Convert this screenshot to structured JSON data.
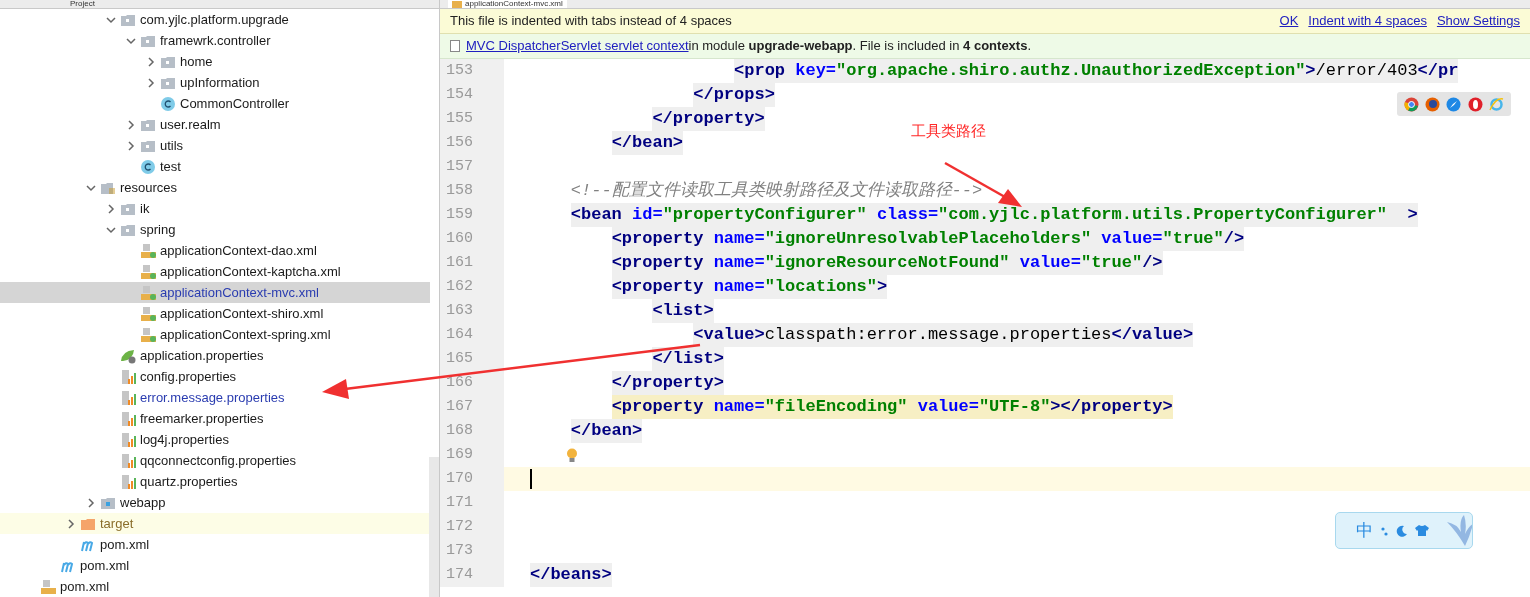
{
  "project_header": {
    "title": "Project"
  },
  "editor_tab": {
    "label": "applicationContext-mvc.xml",
    "selected": true
  },
  "tree": [
    {
      "children": [
        {
          "children": [
            {
              "children": [
                {
                  "children": [
                    {
                      "children": [
                        {
                          "label": "com.yjlc.platform.upgrade",
                          "kind": "package",
                          "expanded": true,
                          "children": [
                            {
                              "label": "framewrk.controller",
                              "kind": "package",
                              "expanded": true,
                              "children": [
                                {
                                  "label": "home",
                                  "kind": "package",
                                  "expanded": false
                                },
                                {
                                  "label": "upInformation",
                                  "kind": "package",
                                  "expanded": false
                                },
                                {
                                  "label": "CommonController",
                                  "kind": "class"
                                }
                              ]
                            },
                            {
                              "label": "user.realm",
                              "kind": "package",
                              "expanded": false
                            },
                            {
                              "label": "utils",
                              "kind": "package",
                              "expanded": false
                            },
                            {
                              "label": "test",
                              "kind": "class"
                            }
                          ]
                        }
                      ]
                    },
                    {
                      "label": "resources",
                      "kind": "resources",
                      "expanded": true,
                      "children": [
                        {
                          "label": "ik",
                          "kind": "package",
                          "expanded": false
                        },
                        {
                          "label": "spring",
                          "kind": "package",
                          "expanded": true,
                          "children": [
                            {
                              "label": "applicationContext-dao.xml",
                              "kind": "springxml",
                              "selected": false,
                              "modified": false
                            },
                            {
                              "label": "applicationContext-kaptcha.xml",
                              "kind": "springxml",
                              "selected": false,
                              "modified": false
                            },
                            {
                              "label": "applicationContext-mvc.xml",
                              "kind": "springxml",
                              "selected": true,
                              "modified": true
                            },
                            {
                              "label": "applicationContext-shiro.xml",
                              "kind": "springxml",
                              "selected": false,
                              "modified": false
                            },
                            {
                              "label": "applicationContext-spring.xml",
                              "kind": "springxml",
                              "selected": false,
                              "modified": false
                            }
                          ]
                        },
                        {
                          "label": "application.properties",
                          "kind": "springprops",
                          "selected": false,
                          "modified": false
                        },
                        {
                          "label": "config.properties",
                          "kind": "properties",
                          "selected": false,
                          "modified": false
                        },
                        {
                          "label": "error.message.properties",
                          "kind": "properties",
                          "selected": false,
                          "modified": true
                        },
                        {
                          "label": "freemarker.properties",
                          "kind": "properties",
                          "selected": false,
                          "modified": false
                        },
                        {
                          "label": "log4j.properties",
                          "kind": "properties",
                          "selected": false,
                          "modified": false
                        },
                        {
                          "label": "qqconnectconfig.properties",
                          "kind": "properties",
                          "selected": false,
                          "modified": false
                        },
                        {
                          "label": "quartz.properties",
                          "kind": "properties",
                          "selected": false,
                          "modified": false
                        }
                      ]
                    },
                    {
                      "label": "webapp",
                      "kind": "webapp",
                      "expanded": false
                    }
                  ]
                },
                {
                  "label": "target",
                  "kind": "target",
                  "expanded": false,
                  "excluded": true
                },
                {
                  "label": "pom.xml",
                  "kind": "maven"
                }
              ]
            },
            {
              "label": "pom.xml",
              "kind": "maven"
            }
          ]
        },
        {
          "label": "pom.xml",
          "kind": "xml"
        }
      ]
    }
  ],
  "notice": {
    "text": "This file is indented with tabs instead of 4 spaces",
    "links": [
      "OK",
      "Indent with 4 spaces",
      "Show Settings"
    ]
  },
  "context_bar": {
    "link": "MVC DispatcherServlet servlet context",
    "text": "in module **upgrade-webapp**. File is included in **4 contexts**."
  },
  "code_lines": [
    {
      "number": "153",
      "current": false,
      "highlighted": true,
      "matched": false,
      "segments": [
        {
          "kind": "tag",
          "text": "\t\t\t\t\t<prop "
        },
        {
          "kind": "attr",
          "text": "key="
        },
        {
          "kind": "value",
          "text": "\"org.apache.shiro.authz.UnauthorizedException\""
        },
        {
          "kind": "tag",
          "text": ">"
        },
        {
          "kind": "text",
          "text": "/error/403"
        },
        {
          "kind": "tag",
          "text": "</pr"
        }
      ]
    },
    {
      "number": "154",
      "current": false,
      "highlighted": true,
      "matched": false,
      "segments": [
        {
          "kind": "tag",
          "text": "\t\t\t\t</props>"
        }
      ]
    },
    {
      "number": "155",
      "current": false,
      "highlighted": true,
      "matched": false,
      "segments": [
        {
          "kind": "tag",
          "text": "\t\t\t</property>"
        }
      ]
    },
    {
      "number": "156",
      "current": false,
      "highlighted": true,
      "matched": false,
      "segments": [
        {
          "kind": "tag",
          "text": "\t\t</bean>"
        }
      ]
    },
    {
      "number": "157",
      "current": false
    },
    {
      "number": "158",
      "current": false,
      "highlighted": false,
      "matched": false,
      "segments": [
        {
          "kind": "comment",
          "text": "\t<!--配置文件读取工具类映射路径及文件读取路径-->"
        }
      ]
    },
    {
      "number": "159",
      "current": false,
      "highlighted": true,
      "matched": false,
      "segments": [
        {
          "kind": "tag",
          "text": "\t<bean "
        },
        {
          "kind": "attr",
          "text": "id="
        },
        {
          "kind": "value",
          "text": "\"propertyConfigurer\" "
        },
        {
          "kind": "attr",
          "text": "class="
        },
        {
          "kind": "value",
          "text": "\"com.yjlc.platform.utils.PropertyConfigurer\""
        },
        {
          "kind": "tag",
          "text": "  >"
        }
      ]
    },
    {
      "number": "160",
      "current": false,
      "highlighted": true,
      "matched": false,
      "segments": [
        {
          "kind": "tag",
          "text": "\t\t<property "
        },
        {
          "kind": "attr",
          "text": "name="
        },
        {
          "kind": "value",
          "text": "\"ignoreUnresolvablePlaceholders\" "
        },
        {
          "kind": "attr",
          "text": "value="
        },
        {
          "kind": "value",
          "text": "\"true\""
        },
        {
          "kind": "tag",
          "text": "/>"
        }
      ]
    },
    {
      "number": "161",
      "current": false,
      "highlighted": true,
      "matched": false,
      "segments": [
        {
          "kind": "tag",
          "text": "\t\t<property "
        },
        {
          "kind": "attr",
          "text": "name="
        },
        {
          "kind": "value",
          "text": "\"ignoreResourceNotFound\" "
        },
        {
          "kind": "attr",
          "text": "value="
        },
        {
          "kind": "value",
          "text": "\"true\""
        },
        {
          "kind": "tag",
          "text": "/>"
        }
      ]
    },
    {
      "number": "162",
      "current": false,
      "highlighted": true,
      "matched": false,
      "segments": [
        {
          "kind": "tag",
          "text": "\t\t<property "
        },
        {
          "kind": "attr",
          "text": "name="
        },
        {
          "kind": "value",
          "text": "\"locations\""
        },
        {
          "kind": "tag",
          "text": ">"
        }
      ]
    },
    {
      "number": "163",
      "current": false,
      "highlighted": true,
      "matched": false,
      "segments": [
        {
          "kind": "tag",
          "text": "\t\t\t<list>"
        }
      ]
    },
    {
      "number": "164",
      "current": false,
      "highlighted": true,
      "matched": false,
      "segments": [
        {
          "kind": "tag",
          "text": "\t\t\t\t<value>"
        },
        {
          "kind": "text",
          "text": "classpath:error.message.properties"
        },
        {
          "kind": "tag",
          "text": "</value>"
        }
      ]
    },
    {
      "number": "165",
      "current": false,
      "highlighted": true,
      "matched": false,
      "segments": [
        {
          "kind": "tag",
          "text": "\t\t\t</list>"
        }
      ]
    },
    {
      "number": "166",
      "current": false,
      "highlighted": true,
      "matched": false,
      "segments": [
        {
          "kind": "tag",
          "text": "\t\t</property>"
        }
      ]
    },
    {
      "number": "167",
      "current": false,
      "highlighted": true,
      "matched": true,
      "segments": [
        {
          "kind": "tag",
          "text": "\t\t<property "
        },
        {
          "kind": "attr",
          "text": "name="
        },
        {
          "kind": "value",
          "text": "\"fileEncoding\" "
        },
        {
          "kind": "attr",
          "text": "value="
        },
        {
          "kind": "value",
          "text": "\"UTF-8\""
        },
        {
          "kind": "tag",
          "text": "></property>"
        }
      ]
    },
    {
      "number": "168",
      "current": false,
      "highlighted": true,
      "matched": false,
      "segments": [
        {
          "kind": "tag",
          "text": "\t</bean>"
        }
      ]
    },
    {
      "number": "169",
      "current": false
    },
    {
      "number": "170",
      "current": true
    },
    {
      "number": "171",
      "current": false
    },
    {
      "number": "172",
      "current": false
    },
    {
      "number": "173",
      "current": false
    },
    {
      "number": "174",
      "current": false,
      "highlighted": true,
      "matched": false,
      "segments": [
        {
          "kind": "tag",
          "text": "</beans>"
        }
      ]
    }
  ],
  "annotation": {
    "text": "工具类路径"
  },
  "ime_bar": {
    "mode": "中"
  }
}
